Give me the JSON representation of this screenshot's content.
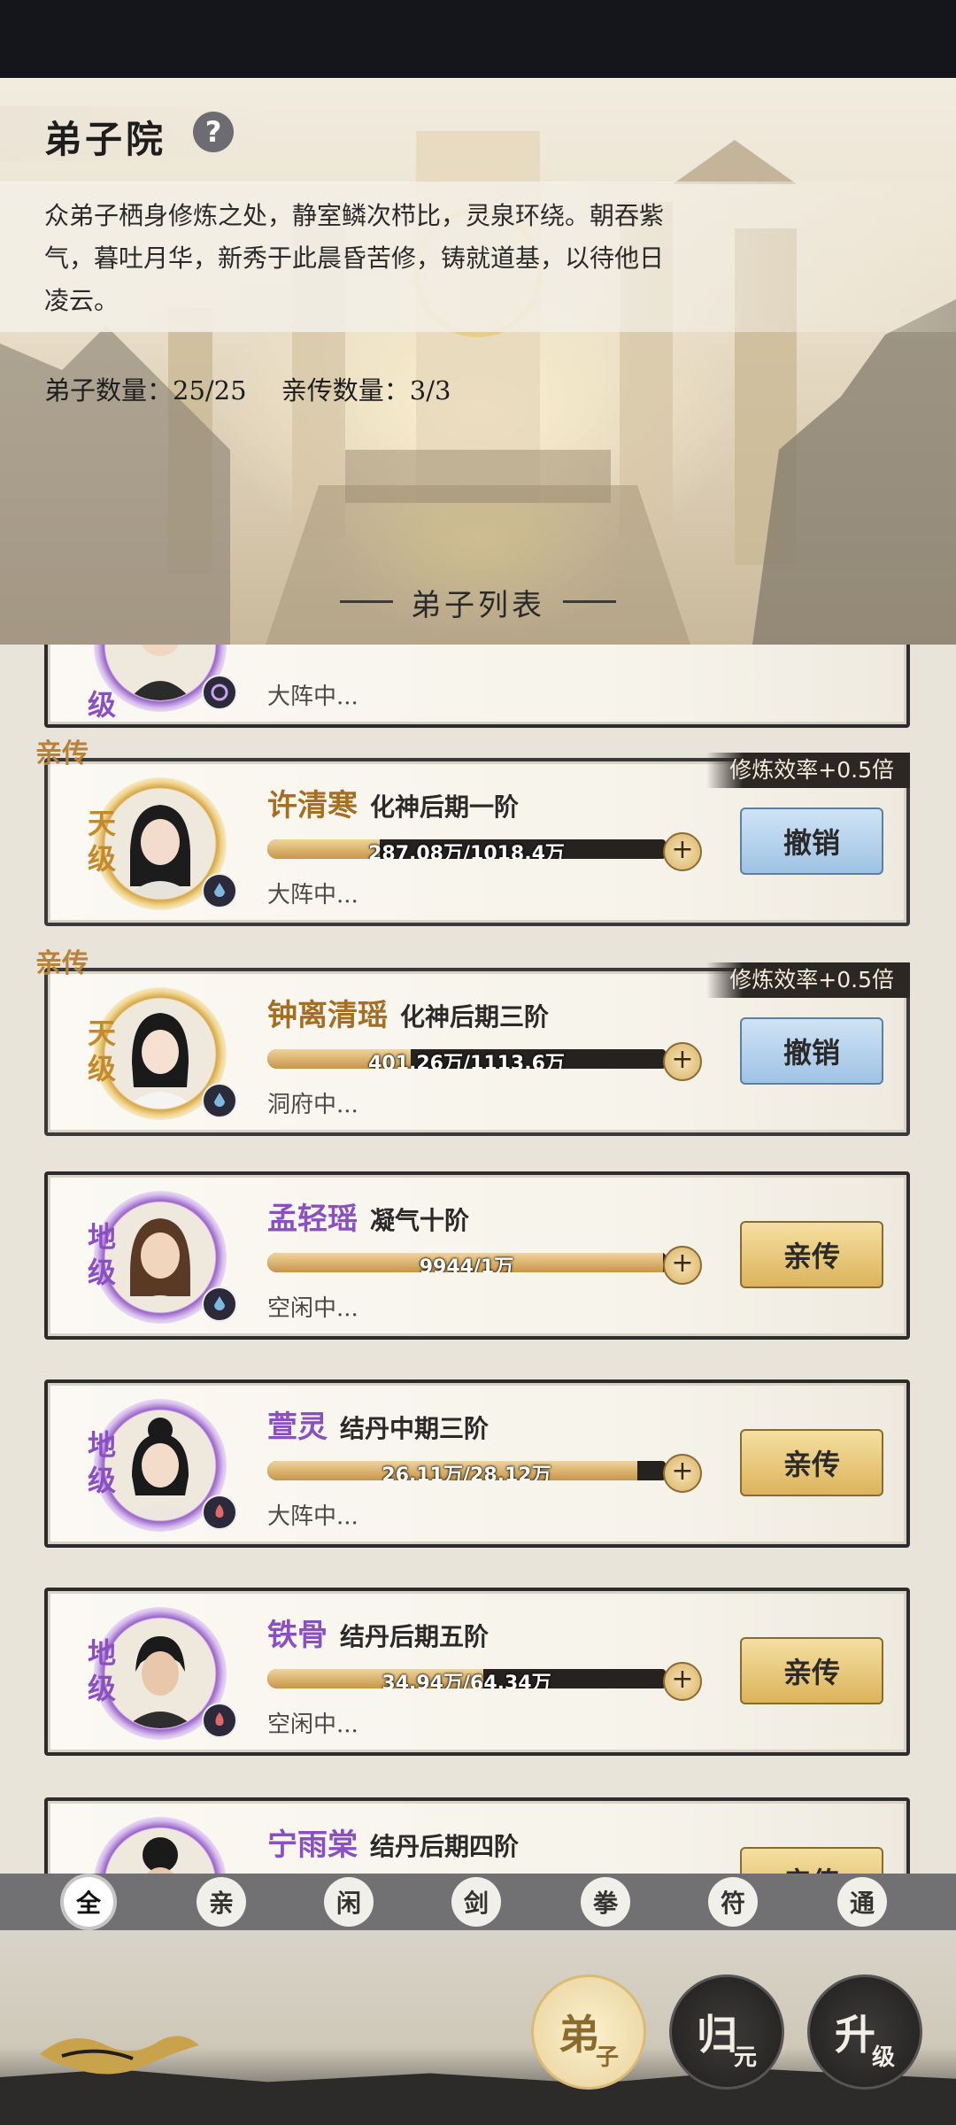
{
  "header": {
    "title": "弟子院",
    "help_icon": "?",
    "description": "众弟子栖身修炼之处，静室鳞次栉比，灵泉环绕。朝吞紫气，暮吐月华，新秀于此晨昏苦修，铸就道基，以待他日凌云。",
    "disciple_count": "弟子数量：25/25",
    "qinchuan_count": "亲传数量：3/3",
    "list_title": "弟子列表"
  },
  "top_card": {
    "grade": "级",
    "status": "大阵中..."
  },
  "cards": [
    {
      "tag": "亲传",
      "bonus": "修炼效率+0.5倍",
      "grade": "天级",
      "name": "许清寒",
      "realm": "化神后期一阶",
      "progress_text": "287.08万/1018.4万",
      "progress": 0.282,
      "status": "大阵中...",
      "action": "撤销",
      "element_icon": "water-icon"
    },
    {
      "tag": "亲传",
      "bonus": "修炼效率+0.5倍",
      "grade": "天级",
      "name": "钟离清瑶",
      "realm": "化神后期三阶",
      "progress_text": "401.26万/1113.6万",
      "progress": 0.36,
      "status": "洞府中...",
      "action": "撤销",
      "element_icon": "water-icon"
    },
    {
      "grade": "地级",
      "name": "孟轻瑶",
      "realm": "凝气十阶",
      "progress_text": "9944/1万",
      "progress": 0.994,
      "status": "空闲中...",
      "action": "亲传",
      "element_icon": "water-icon"
    },
    {
      "grade": "地级",
      "name": "萱灵",
      "realm": "结丹中期三阶",
      "progress_text": "26.11万/28.12万",
      "progress": 0.928,
      "status": "大阵中...",
      "action": "亲传",
      "element_icon": "fire-icon"
    },
    {
      "grade": "地级",
      "name": "铁骨",
      "realm": "结丹后期五阶",
      "progress_text": "34.94万/64.34万",
      "progress": 0.543,
      "status": "空闲中...",
      "action": "亲传",
      "element_icon": "fire-icon"
    },
    {
      "name": "宁雨棠",
      "realm": "结丹后期四阶",
      "action": "亲传"
    }
  ],
  "filters": [
    "全",
    "亲",
    "闲",
    "剑",
    "拳",
    "符",
    "通"
  ],
  "nav": [
    {
      "main": "弟",
      "sub": "子"
    },
    {
      "main": "归",
      "sub": "元"
    },
    {
      "main": "升",
      "sub": "级"
    }
  ],
  "colors": {
    "gold_name": "#a46f22",
    "purple_name": "#8a4fc0",
    "button_blue": "#9fc3e5",
    "button_gold": "#dcb45c"
  }
}
